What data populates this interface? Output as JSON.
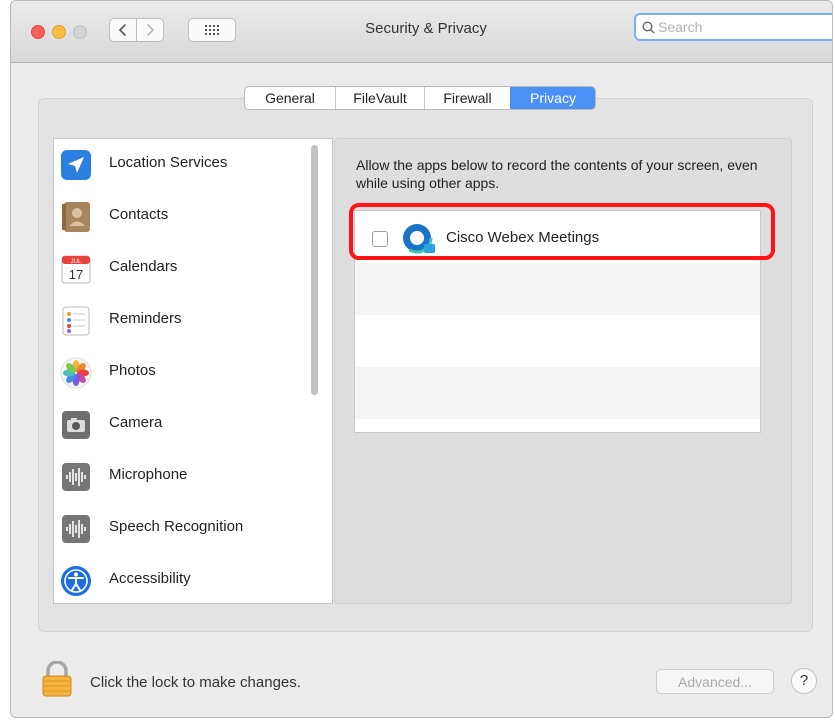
{
  "window": {
    "title": "Security & Privacy",
    "search_placeholder": "Search",
    "search_value": "",
    "nav_back_icon": "chevron-left-icon",
    "nav_forward_icon": "chevron-right-icon",
    "grid_icon": "grid-icon"
  },
  "tabs": [
    {
      "label": "General",
      "active": false
    },
    {
      "label": "FileVault",
      "active": false
    },
    {
      "label": "Firewall",
      "active": false
    },
    {
      "label": "Privacy",
      "active": true
    }
  ],
  "sidebar": {
    "items": [
      {
        "label": "Location Services",
        "icon": "location-arrow-icon"
      },
      {
        "label": "Contacts",
        "icon": "contacts-book-icon"
      },
      {
        "label": "Calendars",
        "icon": "calendar-icon",
        "icon_month": "JUL",
        "icon_day": "17"
      },
      {
        "label": "Reminders",
        "icon": "reminders-list-icon"
      },
      {
        "label": "Photos",
        "icon": "photos-flower-icon"
      },
      {
        "label": "Camera",
        "icon": "camera-icon"
      },
      {
        "label": "Microphone",
        "icon": "microphone-waveform-icon"
      },
      {
        "label": "Speech Recognition",
        "icon": "speech-waveform-icon"
      },
      {
        "label": "Accessibility",
        "icon": "accessibility-icon"
      }
    ]
  },
  "main": {
    "description": "Allow the apps below to record the contents of your screen, even while using other apps.",
    "apps": [
      {
        "name": "Cisco Webex Meetings",
        "checked": false,
        "icon": "webex-icon"
      }
    ]
  },
  "footer": {
    "lock_text": "Click the lock to make changes.",
    "lock_icon": "padlock-icon",
    "advanced_label": "Advanced...",
    "help_label": "?"
  },
  "colors": {
    "accent": "#4a90f5",
    "highlight": "#ff1313",
    "window_bg": "#ececec"
  }
}
